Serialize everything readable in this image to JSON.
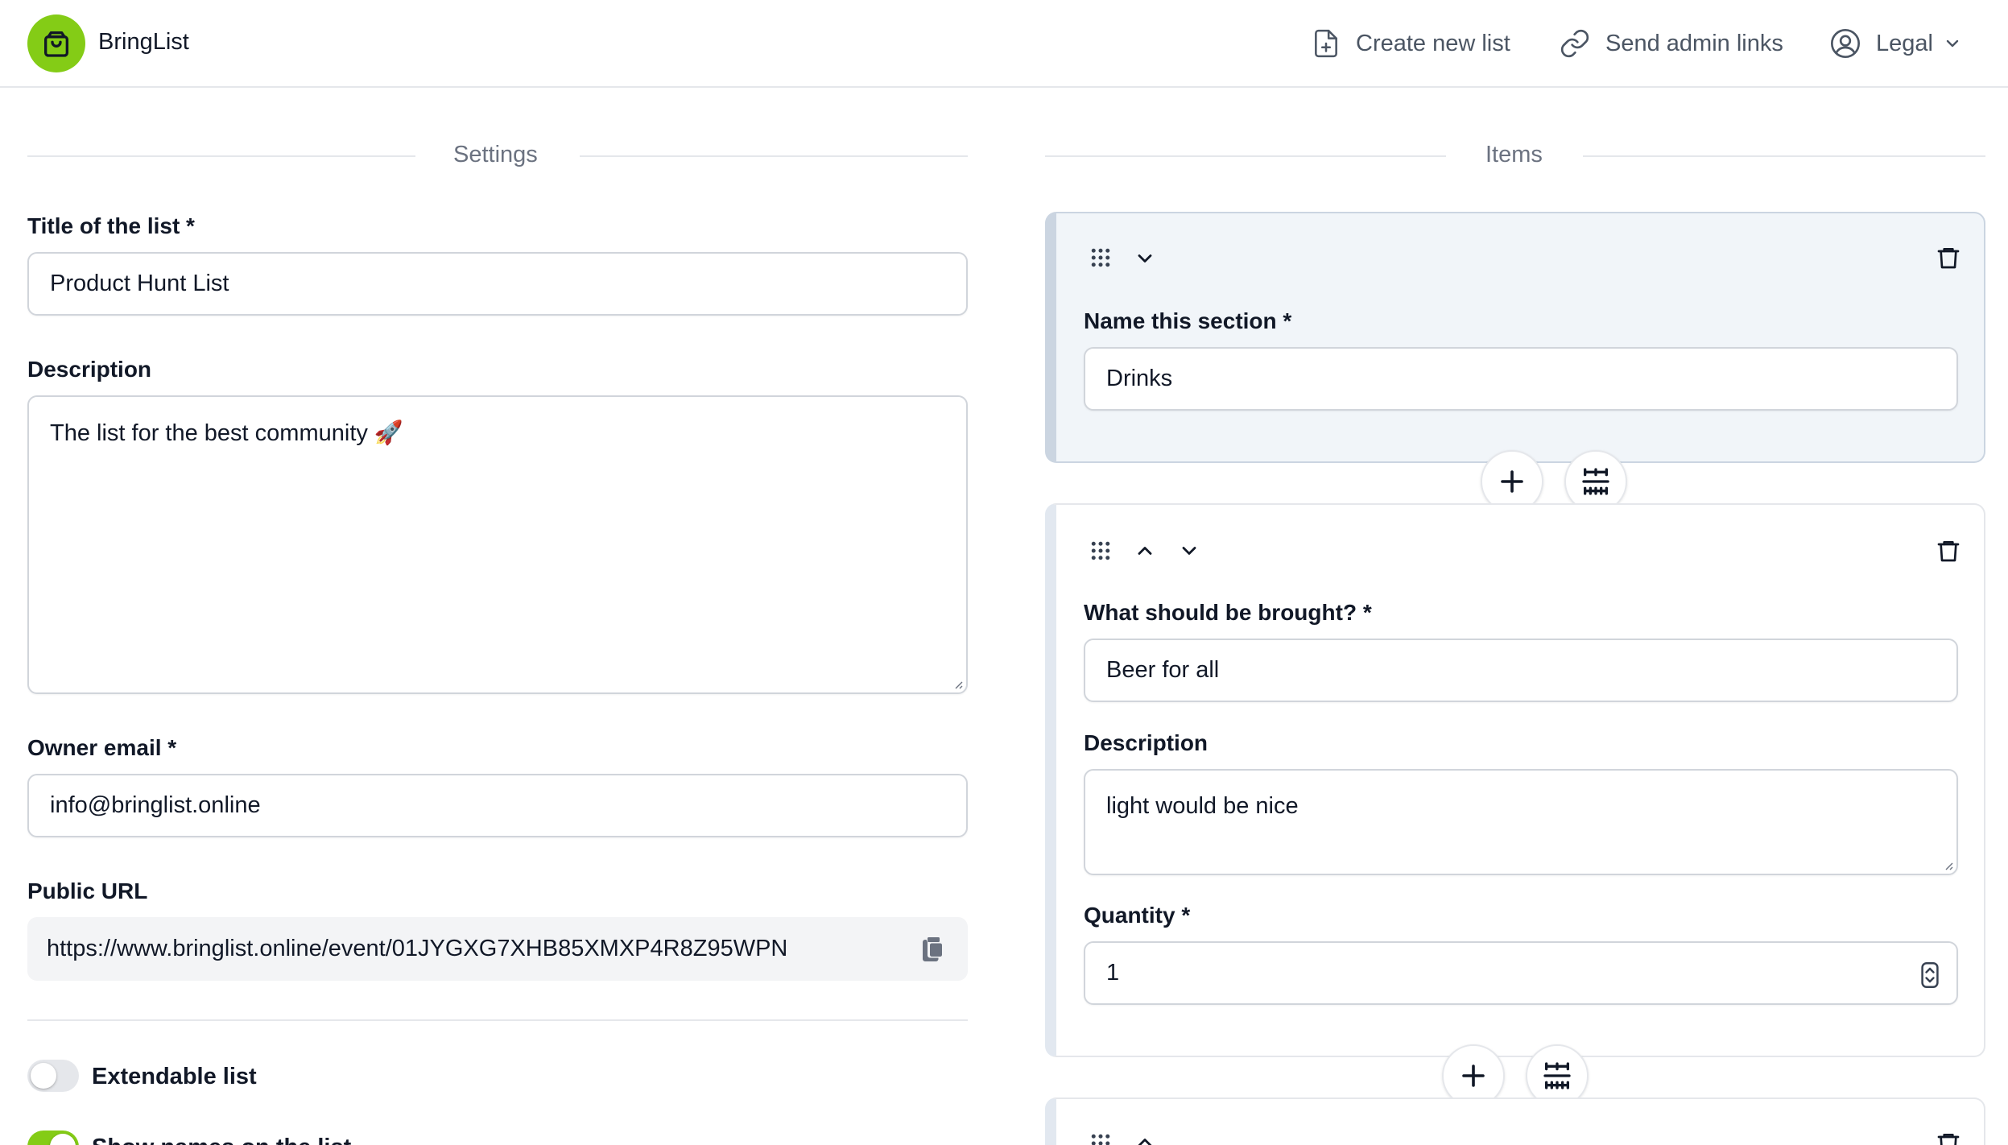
{
  "app": {
    "name": "BringList",
    "brand_color": "#84cc16"
  },
  "header": {
    "create_label": "Create new list",
    "admin_label": "Send admin links",
    "account_label": "Legal"
  },
  "settings": {
    "heading": "Settings",
    "title_label": "Title of the list *",
    "title_value": "Product Hunt List",
    "description_label": "Description",
    "description_value": "The list for the best community 🚀",
    "email_label": "Owner email *",
    "email_value": "info@bringlist.online",
    "public_url_label": "Public URL",
    "public_url_value": "https://www.bringlist.online/event/01JYGXG7XHB85XMXP4R8Z95WPN",
    "extendable_label": "Extendable list",
    "extendable_on": false,
    "show_names_label": "Show names on the list",
    "show_names_on": true
  },
  "items": {
    "heading": "Items",
    "section": {
      "name_label": "Name this section *",
      "name_value": "Drinks"
    },
    "item": {
      "what_label": "What should be brought? *",
      "what_value": "Beer for all",
      "description_label": "Description",
      "description_value": "light would be nice",
      "quantity_label": "Quantity *",
      "quantity_value": "1"
    }
  }
}
